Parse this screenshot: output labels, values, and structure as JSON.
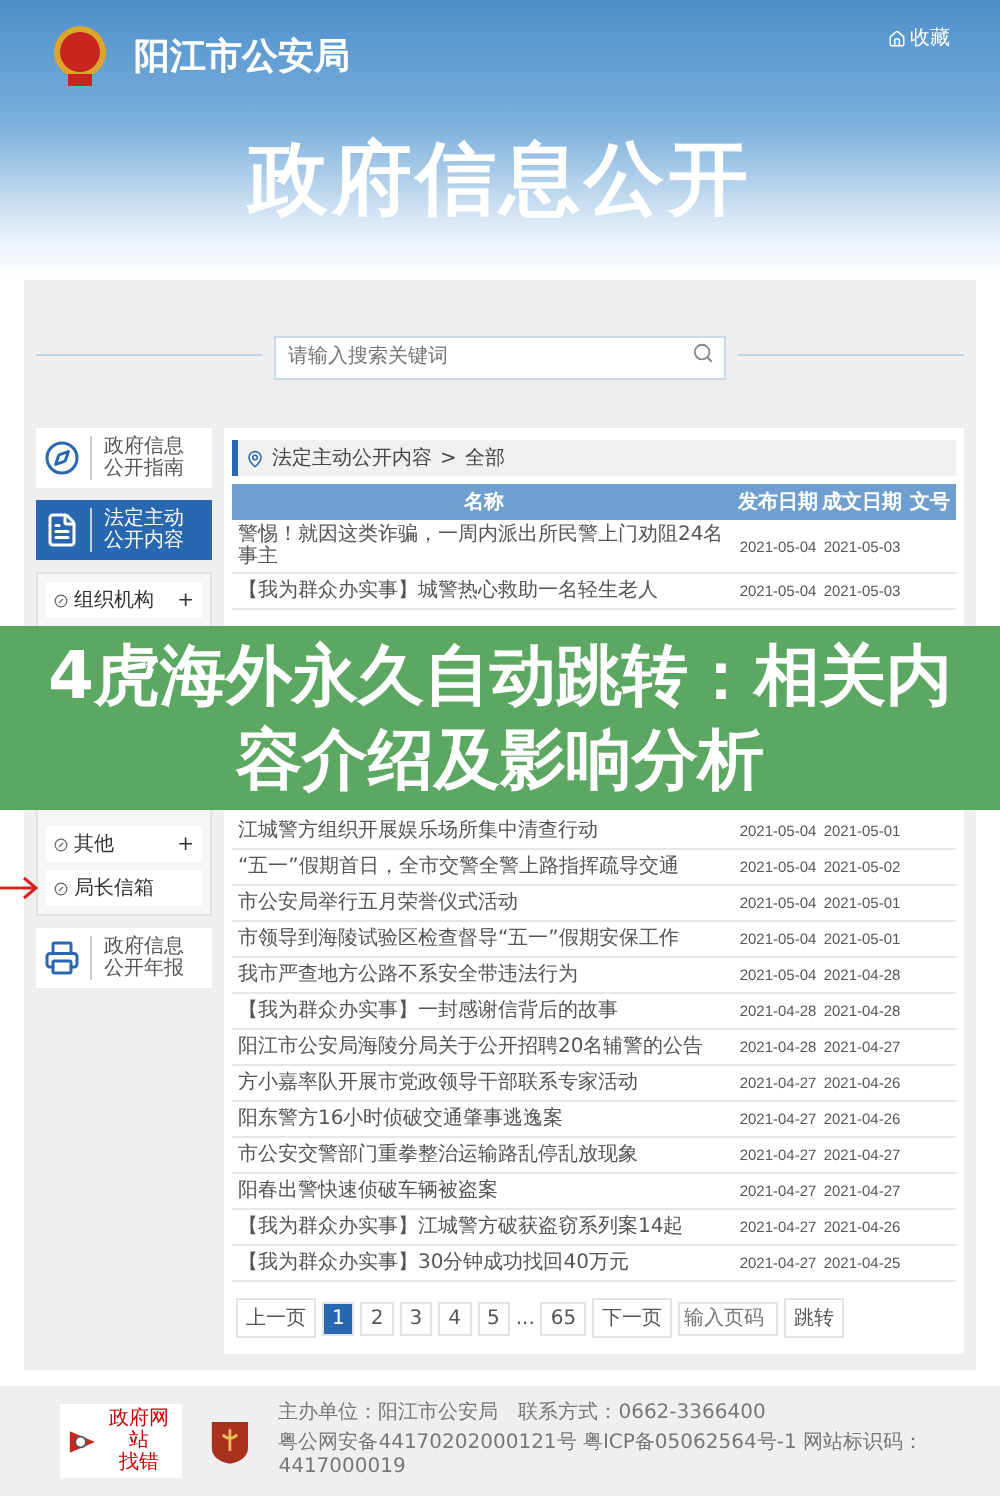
{
  "header": {
    "site_name": "阳江市公安局",
    "bookmark": "收藏",
    "title": "政府信息公开"
  },
  "search": {
    "placeholder": "请输入搜索关键词"
  },
  "sidebar": {
    "guide": {
      "lines": [
        "政府信息",
        "公开指南"
      ],
      "selected": false
    },
    "content": {
      "lines": [
        "法定主动",
        "公开内容"
      ],
      "selected": true
    },
    "menu_before": [
      {
        "label": "组织机构",
        "toggle": "+",
        "marked": false
      }
    ],
    "menu_after": [
      {
        "label": "其他",
        "toggle": "+",
        "marked": false
      },
      {
        "label": "局长信箱",
        "marked": true
      }
    ],
    "report": {
      "lines": [
        "政府信息",
        "公开年报"
      ],
      "selected": false
    }
  },
  "breadcrumb": {
    "items": [
      "法定主动公开内容",
      "全部"
    ],
    "separator": ">"
  },
  "table": {
    "columns": [
      "名称",
      "发布日期",
      "成文日期",
      "文号"
    ],
    "rows_before": [
      {
        "title": "警惕！就因这类诈骗，一周内派出所民警上门劝阻24名事主",
        "published": "2021-05-04",
        "written": "2021-05-03"
      },
      {
        "title": "【我为群众办实事】城警热心救助一名轻生老人",
        "published": "2021-05-04",
        "written": "2021-05-03"
      }
    ],
    "rows_after": [
      {
        "title": "江城警方组织开展娱乐场所集中清查行动",
        "published": "2021-05-04",
        "written": "2021-05-01"
      },
      {
        "title": "“五一”假期首日，全市交警全警上路指挥疏导交通",
        "published": "2021-05-04",
        "written": "2021-05-02"
      },
      {
        "title": "市公安局举行五月荣誉仪式活动",
        "published": "2021-05-04",
        "written": "2021-05-01"
      },
      {
        "title": "市领导到海陵试验区检查督导“五一”假期安保工作",
        "published": "2021-05-04",
        "written": "2021-05-01"
      },
      {
        "title": "我市严查地方公路不系安全带违法行为",
        "published": "2021-05-04",
        "written": "2021-04-28"
      },
      {
        "title": "【我为群众办实事】一封感谢信背后的故事",
        "published": "2021-04-28",
        "written": "2021-04-28"
      },
      {
        "title": "阳江市公安局海陵分局关于公开招聘20名辅警的公告",
        "published": "2021-04-28",
        "written": "2021-04-27"
      },
      {
        "title": "方小嘉率队开展市党政领导干部联系专家活动",
        "published": "2021-04-27",
        "written": "2021-04-26"
      },
      {
        "title": "阳东警方16小时侦破交通肇事逃逸案",
        "published": "2021-04-27",
        "written": "2021-04-26"
      },
      {
        "title": "市公安交警部门重拳整治运输路乱停乱放现象",
        "published": "2021-04-27",
        "written": "2021-04-27"
      },
      {
        "title": "阳春出警快速侦破车辆被盗案",
        "published": "2021-04-27",
        "written": "2021-04-27"
      },
      {
        "title": "【我为群众办实事】江城警方破获盗窃系列案14起",
        "published": "2021-04-27",
        "written": "2021-04-26"
      },
      {
        "title": "【我为群众办实事】30分钟成功找回40万元",
        "published": "2021-04-27",
        "written": "2021-04-25"
      }
    ]
  },
  "pagination": {
    "prev": "上一页",
    "pages": [
      {
        "kind": "page",
        "label": "1",
        "selected": true
      },
      {
        "kind": "page",
        "label": "2",
        "selected": false
      },
      {
        "kind": "page",
        "label": "3",
        "selected": false
      },
      {
        "kind": "page",
        "label": "4",
        "selected": false
      },
      {
        "kind": "page",
        "label": "5",
        "selected": false
      },
      {
        "kind": "ellipsis",
        "label": "...",
        "selected": false
      },
      {
        "kind": "page",
        "label": "65",
        "selected": false
      }
    ],
    "next": "下一页",
    "page_input": {
      "placeholder": "输入页码"
    },
    "jump": "跳转"
  },
  "footer": {
    "badge": {
      "top": "政府网站",
      "bottom": "找错"
    },
    "lines": [
      "主办单位：阳江市公安局　联系方式：0662-3366400",
      "粤公网安备44170202000121号 粤ICP备05062564号-1 网站标识码：4417000019"
    ]
  },
  "banner": {
    "text": "4虎海外永久自动跳转：相关内容介绍及影响分析"
  }
}
